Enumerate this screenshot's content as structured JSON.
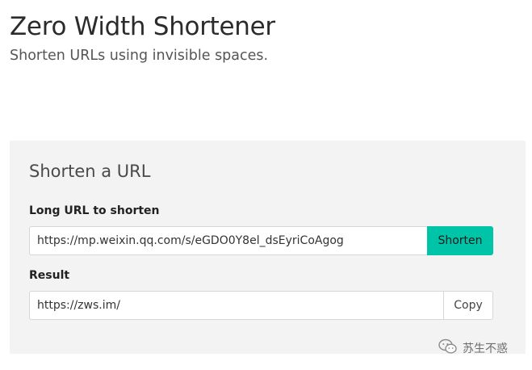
{
  "header": {
    "title": "Zero Width Shortener",
    "subtitle": "Shorten URLs using invisible spaces."
  },
  "card": {
    "title": "Shorten a URL",
    "long_url_label": "Long URL to shorten",
    "long_url_value": "https://mp.weixin.qq.com/s/eGDO0Y8el_dsEyriCoAgog",
    "shorten_label": "Shorten",
    "result_label": "Result",
    "result_value": "https://zws.im/",
    "copy_label": "Copy"
  },
  "watermark": {
    "icon": "wechat-icon",
    "text": "苏生不惑"
  },
  "colors": {
    "accent": "#00c4a7",
    "card_bg": "#f3f3f3"
  }
}
